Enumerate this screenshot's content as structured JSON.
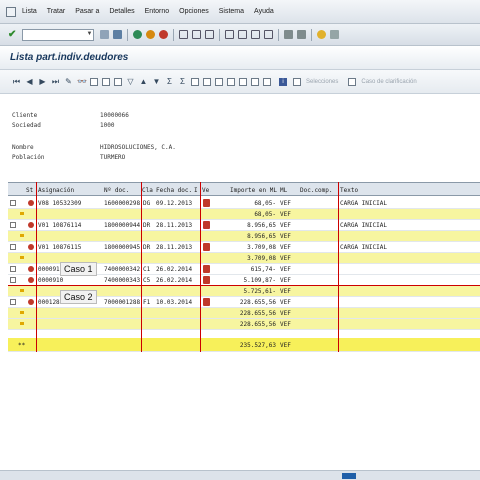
{
  "menu": {
    "items": [
      "Lista",
      "Tratar",
      "Pasar a",
      "Detalles",
      "Entorno",
      "Opciones",
      "Sistema",
      "Ayuda"
    ]
  },
  "toolbar": {
    "command_value": ""
  },
  "title": "Lista part.indiv.deudores",
  "apptool": {
    "selecciones": "Selecciones",
    "caso_clarificacion": "Caso de clarificación"
  },
  "header": [
    {
      "label": "Cliente",
      "value": "10000066"
    },
    {
      "label": "Sociedad",
      "value": "1000"
    },
    {
      "label": "Nombre",
      "value": "HIDROSOLUCIONES, C.A."
    },
    {
      "label": "Población",
      "value": "TURMERO"
    }
  ],
  "columns": [
    "St",
    "Asignación",
    "Nº doc.",
    "Cla",
    "Fecha doc.",
    "I",
    "Ve",
    "Importe en ML",
    "ML",
    "Doc.comp.",
    "Texto"
  ],
  "rows": [
    {
      "asignacion": "V08 10532309",
      "doc": "1600000298",
      "cla": "DG",
      "fecha": "09.12.2013",
      "importe": "68,05-",
      "ml": "VEF",
      "texto": "CARGA INICIAL"
    },
    {
      "subtotal": "68,05-",
      "ml": "VEF"
    },
    {
      "asignacion": "V01 10876114",
      "doc": "1800000944",
      "cla": "DR",
      "fecha": "28.11.2013",
      "importe": "8.956,65",
      "ml": "VEF",
      "texto": "CARGA INICIAL"
    },
    {
      "subtotal": "8.956,65",
      "ml": "VEF"
    },
    {
      "asignacion": "V01 10876115",
      "doc": "1800000945",
      "cla": "DR",
      "fecha": "28.11.2013",
      "importe": "3.709,08",
      "ml": "VEF",
      "texto": "CARGA INICIAL"
    },
    {
      "subtotal": "3.709,08",
      "ml": "VEF"
    },
    {
      "asignacion": "0000910",
      "doc": "7400000342",
      "cla": "C1",
      "fecha": "26.02.2014",
      "importe": "615,74-",
      "ml": "VEF",
      "texto": ""
    },
    {
      "asignacion": "0000910",
      "doc": "7400000343",
      "cla": "C5",
      "fecha": "26.02.2014",
      "importe": "5.109,87-",
      "ml": "VEF",
      "texto": ""
    },
    {
      "subtotal": "5.725,61-",
      "ml": "VEF"
    },
    {
      "asignacion": "0001288",
      "doc": "7000001288",
      "cla": "F1",
      "fecha": "10.03.2014",
      "importe": "228.655,56",
      "ml": "VEF",
      "texto": ""
    },
    {
      "subtotal": "228.655,56",
      "ml": "VEF"
    },
    {
      "subtotal": "228.655,56",
      "ml": "VEF"
    }
  ],
  "grand_total": {
    "marker": "**",
    "importe": "235.527,63",
    "ml": "VEF"
  },
  "annotations": {
    "caso1": "Caso 1",
    "caso2": "Caso 2"
  },
  "colors": {
    "accent_red": "#cc0000",
    "total_yellow": "#f7f05a",
    "title_blue": "#16365c"
  }
}
